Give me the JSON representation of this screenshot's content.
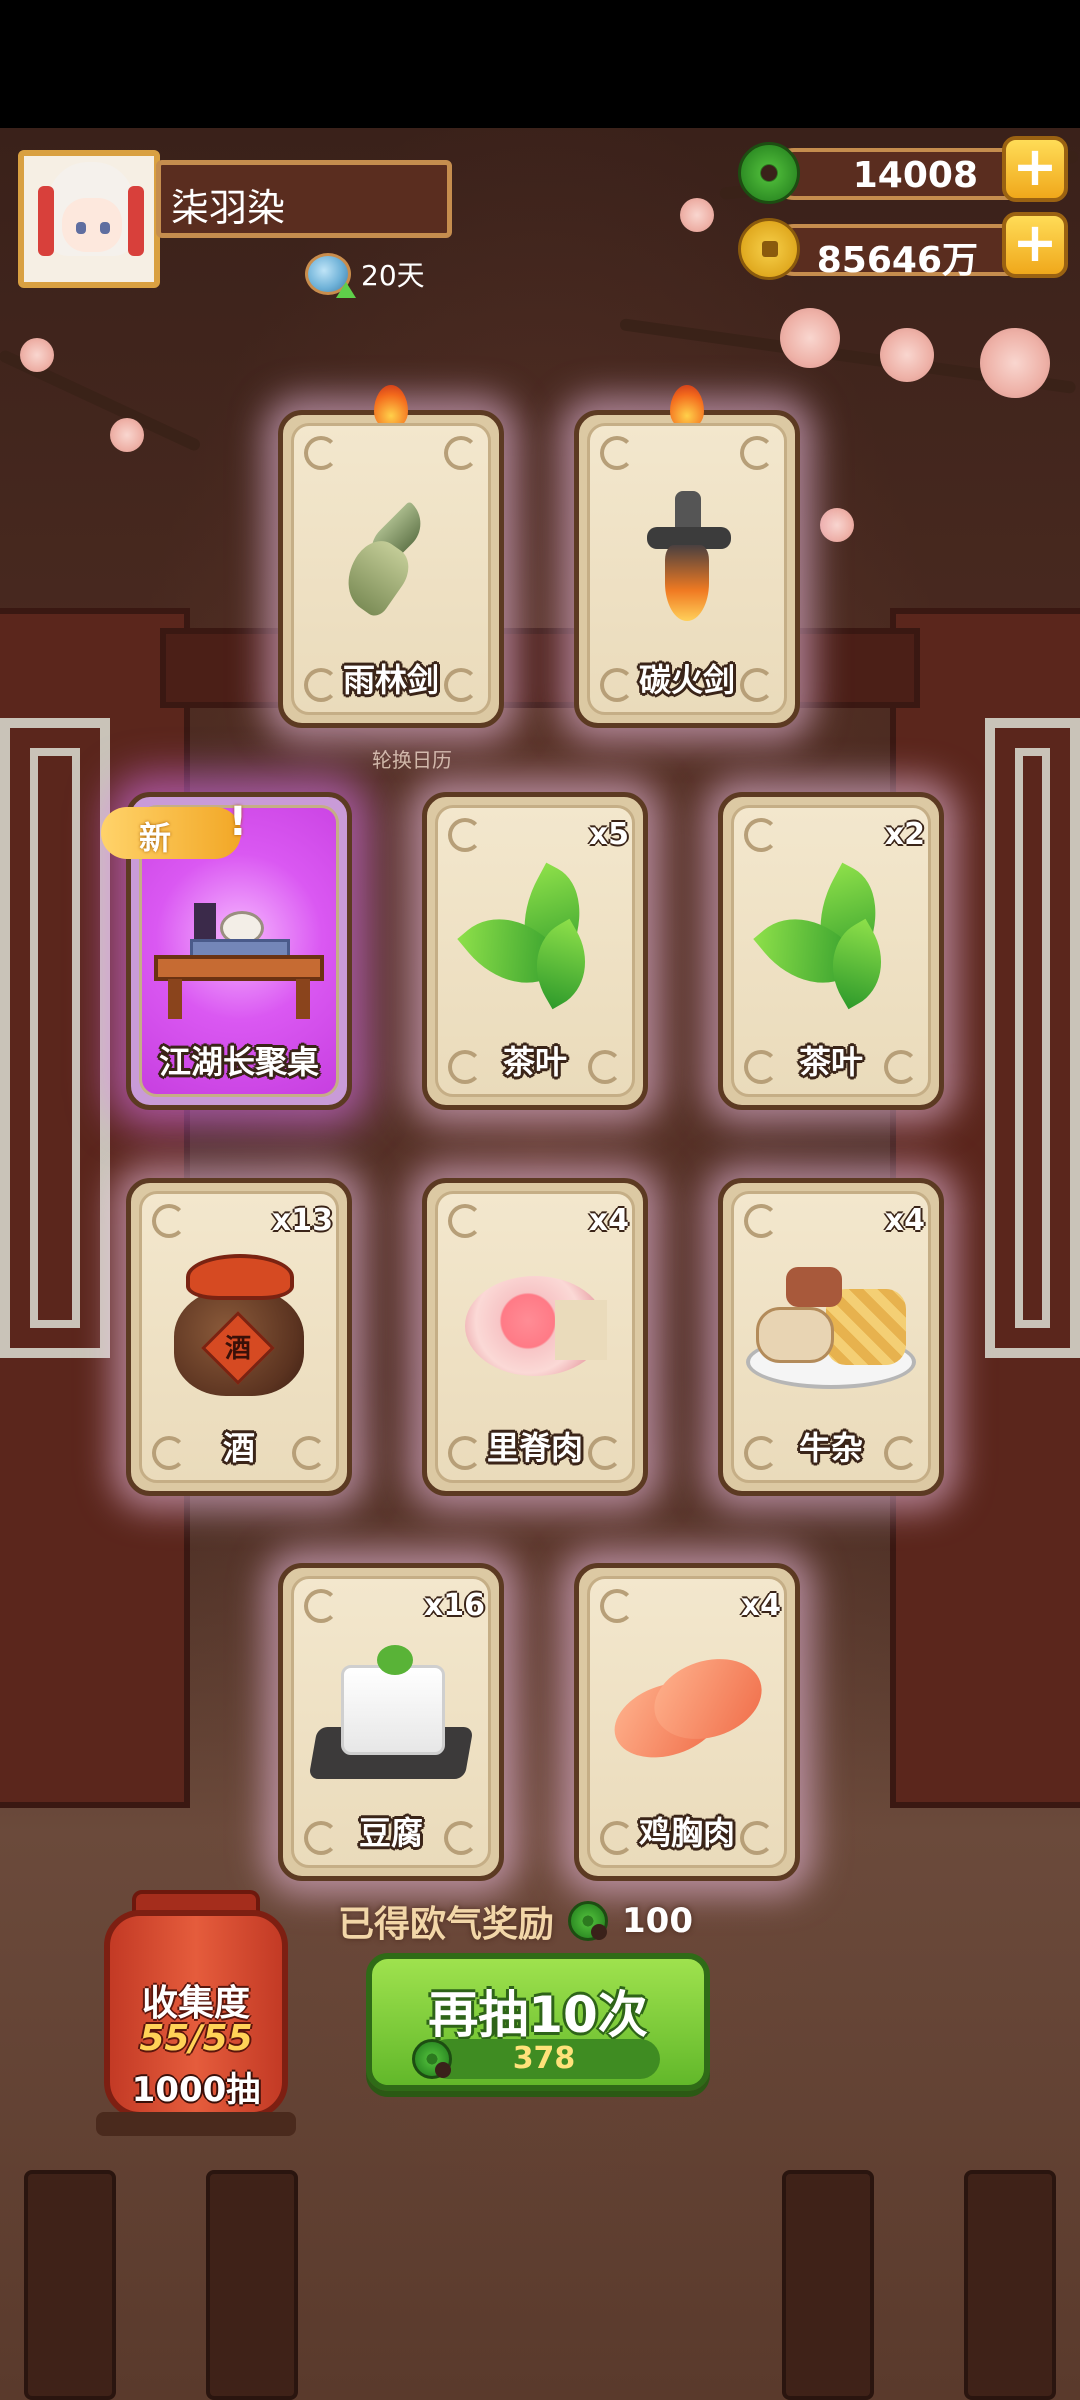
{
  "player": {
    "name": "柒羽染",
    "days": "20天"
  },
  "currencies": {
    "jade": "14008",
    "gold": "85646万",
    "add_symbol": "+"
  },
  "background": {
    "calendar_label": "轮换日历"
  },
  "cards": [
    {
      "name": "雨林剑",
      "qty": "",
      "icon": "rainforest-sword-icon",
      "flame": true
    },
    {
      "name": "碳火剑",
      "qty": "",
      "icon": "charcoal-fire-sword-icon",
      "flame": true
    },
    {
      "name": "江湖长聚桌",
      "qty": "",
      "icon": "gathering-table-icon",
      "is_new": true,
      "new_label": "新"
    },
    {
      "name": "茶叶",
      "qty": "x5",
      "icon": "tea-leaf-icon"
    },
    {
      "name": "茶叶",
      "qty": "x2",
      "icon": "tea-leaf-icon"
    },
    {
      "name": "酒",
      "qty": "x13",
      "icon": "wine-jar-icon",
      "jar_label": "酒"
    },
    {
      "name": "里脊肉",
      "qty": "x4",
      "icon": "tenderloin-icon"
    },
    {
      "name": "牛杂",
      "qty": "x4",
      "icon": "beef-offal-icon"
    },
    {
      "name": "豆腐",
      "qty": "x16",
      "icon": "tofu-icon"
    },
    {
      "name": "鸡胸肉",
      "qty": "x4",
      "icon": "chicken-breast-icon"
    }
  ],
  "reward": {
    "label": "已得欧气奖励",
    "amount": "100"
  },
  "draw": {
    "label": "再抽10次",
    "cost": "378"
  },
  "collection": {
    "title": "收集度",
    "progress": "55/55",
    "draws": "1000抽"
  }
}
